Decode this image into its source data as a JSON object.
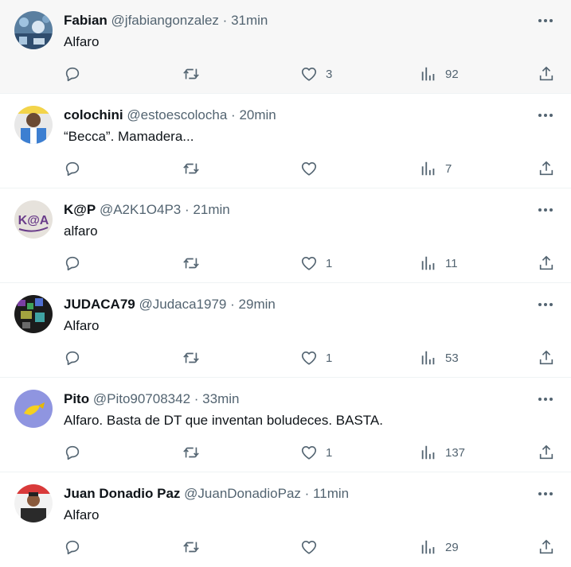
{
  "tweets": [
    {
      "name": "Fabian",
      "handle": "@jfabiangonzalez",
      "separator": "·",
      "time": "31min",
      "text": "Alfaro",
      "likes": "3",
      "views": "92",
      "hover": true
    },
    {
      "name": "colochini",
      "handle": "@estoescolocha",
      "separator": "·",
      "time": "20min",
      "text": "“Becca”. Mamadera...",
      "likes": "",
      "views": "7",
      "hover": false
    },
    {
      "name": "K@P",
      "handle": "@A2K1O4P3",
      "separator": "·",
      "time": "21min",
      "text": "alfaro",
      "likes": "1",
      "views": "11",
      "hover": false
    },
    {
      "name": "JUDACA79",
      "handle": "@Judaca1979",
      "separator": "·",
      "time": "29min",
      "text": "Alfaro",
      "likes": "1",
      "views": "53",
      "hover": false
    },
    {
      "name": "Pito",
      "handle": "@Pito90708342",
      "separator": "·",
      "time": "33min",
      "text": "Alfaro. Basta de DT que inventan boludeces. BASTA.",
      "likes": "1",
      "views": "137",
      "hover": false
    },
    {
      "name": "Juan Donadio Paz",
      "handle": "@JuanDonadioPaz",
      "separator": "·",
      "time": "11min",
      "text": "Alfaro",
      "likes": "",
      "views": "29",
      "hover": false
    }
  ],
  "icons": {
    "more": "more-horizontal-icon",
    "reply": "reply-icon",
    "retweet": "retweet-icon",
    "like": "heart-icon",
    "views": "views-chart-icon",
    "share": "share-icon"
  },
  "colors": {
    "text": "#0f1419",
    "secondary": "#536471",
    "divider": "#eff3f4",
    "hover_bg": "#f7f7f7"
  }
}
